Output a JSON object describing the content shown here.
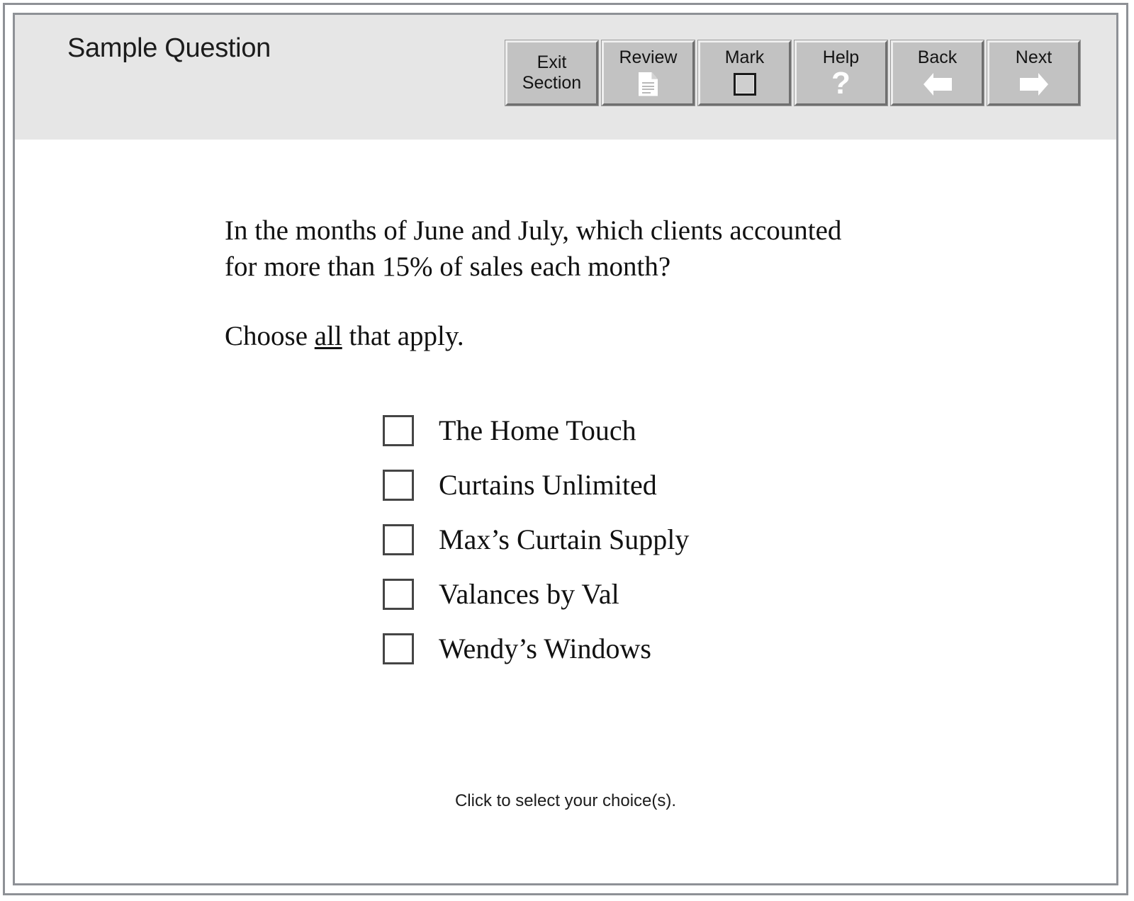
{
  "header": {
    "title": "Sample Question"
  },
  "toolbar": {
    "buttons": [
      {
        "label": "Exit\nSection",
        "icon": "none"
      },
      {
        "label": "Review",
        "icon": "document-icon"
      },
      {
        "label": "Mark",
        "icon": "empty-square-icon"
      },
      {
        "label": "Help",
        "icon": "question-mark-icon"
      },
      {
        "label": "Back",
        "icon": "left-arrow-icon"
      },
      {
        "label": "Next",
        "icon": "right-arrow-icon"
      }
    ]
  },
  "question": {
    "stem_line_1": "In the months of June and July, which clients accounted",
    "stem_line_2": "for more than 15% of sales each month?",
    "instruction_prefix": "Choose ",
    "instruction_emphasis": "all",
    "instruction_suffix": " that apply."
  },
  "options": [
    {
      "label": "The Home Touch",
      "checked": false
    },
    {
      "label": "Curtains Unlimited",
      "checked": false
    },
    {
      "label": "Max’s Curtain Supply",
      "checked": false
    },
    {
      "label": "Valances by Val",
      "checked": false
    },
    {
      "label": "Wendy’s Windows",
      "checked": false
    }
  ],
  "footer": {
    "hint": "Click to select your choice(s)."
  },
  "colors": {
    "header_background": "#e6e6e6",
    "frame_border": "#8e9196",
    "button_face": "#c2c2c2",
    "button_highlight": "#eeeeee",
    "button_shadow": "#6f6f6f",
    "text": "#111111",
    "page_background": "#ffffff"
  }
}
